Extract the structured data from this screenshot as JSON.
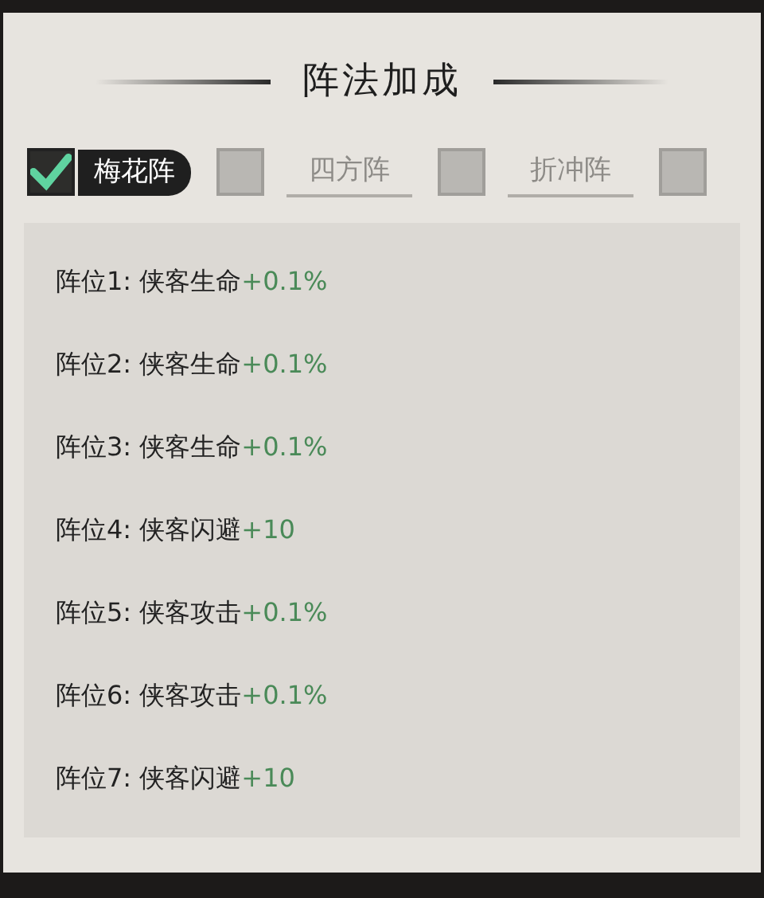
{
  "title": "阵法加成",
  "tabs": [
    {
      "label": "梅花阵",
      "selected": true,
      "checked": true
    },
    {
      "label": "四方阵",
      "selected": false,
      "checked": false
    },
    {
      "label": "折冲阵",
      "selected": false,
      "checked": false
    },
    {
      "checked": false
    }
  ],
  "bonuses": [
    {
      "label": "阵位1: 侠客生命",
      "value": "+0.1%"
    },
    {
      "label": "阵位2: 侠客生命",
      "value": "+0.1%"
    },
    {
      "label": "阵位3: 侠客生命",
      "value": "+0.1%"
    },
    {
      "label": "阵位4: 侠客闪避",
      "value": "+10"
    },
    {
      "label": "阵位5: 侠客攻击",
      "value": "+0.1%"
    },
    {
      "label": "阵位6: 侠客攻击",
      "value": "+0.1%"
    },
    {
      "label": "阵位7: 侠客闪避",
      "value": "+10"
    }
  ]
}
